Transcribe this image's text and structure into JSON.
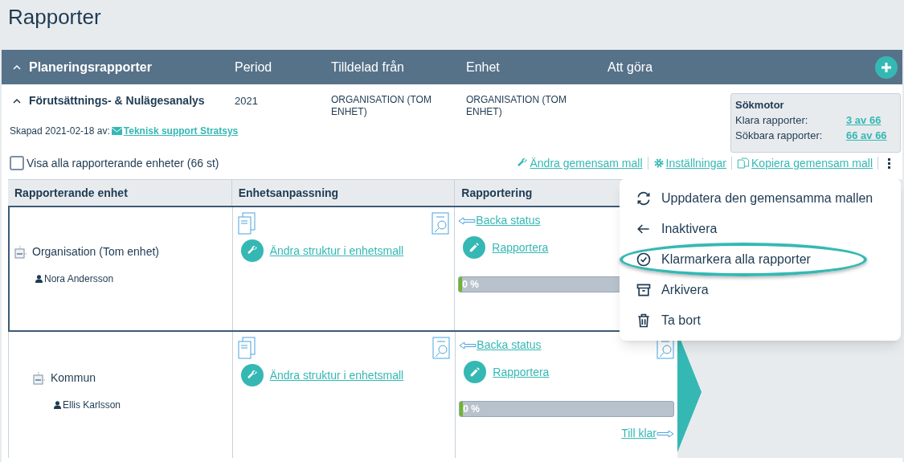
{
  "page_title": "Rapporter",
  "header": {
    "expanded": true,
    "columns": [
      "Planeringsrapporter",
      "Period",
      "Tilldelad från",
      "Enhet",
      "Att göra"
    ]
  },
  "report": {
    "expanded": true,
    "name": "Förutsättnings- & Nulägesanalys",
    "period": "2021",
    "assigned_from": "ORGANISATION (TOM ENHET)",
    "unit": "ORGANISATION (TOM ENHET)",
    "created": "Skapad 2021-02-18 av:",
    "creator": "Teknisk support Stratsys"
  },
  "search_engine": {
    "title": "Sökmotor",
    "rows": [
      {
        "label": "Klara rapporter:",
        "value": "3 av 66"
      },
      {
        "label": "Sökbara rapporter:",
        "value": "66 av 66"
      }
    ]
  },
  "show_all": {
    "label": "Visa alla rapporterande enheter (66 st)",
    "checked": false
  },
  "actions": [
    {
      "kind": "wrench",
      "label": "Ändra gemensam mall"
    },
    {
      "kind": "gear",
      "label": "Inställningar"
    },
    {
      "kind": "copy",
      "label": "Kopiera gemensam mall"
    }
  ],
  "table": {
    "columns": [
      "Rapporterande enhet",
      "Enhetsanpassning",
      "Rapportering"
    ],
    "rows": [
      {
        "unit": "Organisation (Tom enhet)",
        "person": "Nora Andersson",
        "nested": false,
        "selected": true,
        "adapt_link": "Ändra struktur i enhetsmall",
        "back_link": "Backa status",
        "report_link": "Rapportera",
        "progress": "0 %",
        "level": 0,
        "done_link": ""
      },
      {
        "unit": "Kommun",
        "person": "Ellis Karlsson",
        "nested": true,
        "selected": false,
        "adapt_link": "Ändra struktur i enhetsmall",
        "back_link": "Backa status",
        "report_link": "Rapportera",
        "progress": "0 %",
        "level": 0,
        "done_link": "Till klar"
      }
    ]
  },
  "menu": [
    {
      "kind": "refresh",
      "label": "Uppdatera den gemensamma mallen",
      "highlighted": false
    },
    {
      "kind": "back",
      "label": "Inaktivera",
      "highlighted": false
    },
    {
      "kind": "check",
      "label": "Klarmarkera alla rapporter",
      "highlighted": true
    },
    {
      "kind": "archive",
      "label": "Arkivera",
      "highlighted": false
    },
    {
      "kind": "trash",
      "label": "Ta bort",
      "highlighted": false
    }
  ]
}
